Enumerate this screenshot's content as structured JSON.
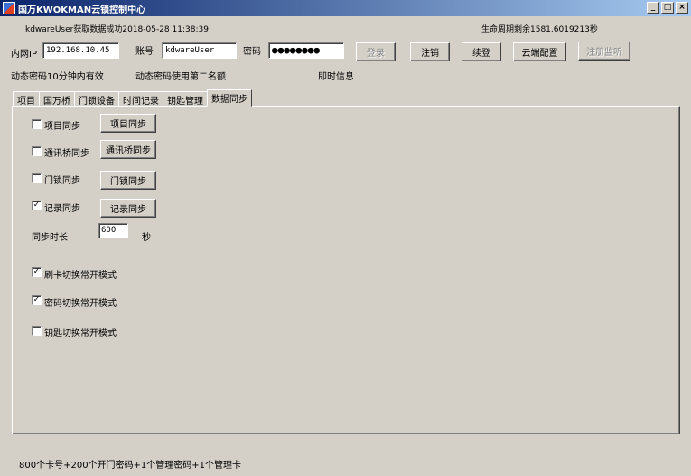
{
  "window": {
    "title": "国万KWOKMAN云锁控制中心"
  },
  "status": {
    "message": "kdwareUser获取数据成功2018-05-28 11:38:39",
    "lifecycle": "生命周期剩余1581.6019213秒"
  },
  "login": {
    "ip_label": "内网IP",
    "ip_value": "192.168.10.45",
    "account_label": "账号",
    "account_value": "kdwareUser",
    "password_label": "密码",
    "password_value": "●●●●●●●●",
    "buttons": {
      "login": "登录",
      "logout": "注销",
      "renew": "续登",
      "cloud_config": "云端配置",
      "register_listen": "注册监听"
    }
  },
  "info": {
    "dynamic_valid": "动态密码10分钟内有效",
    "dynamic_second": "动态密码使用第二名额",
    "realtime": "即时信息"
  },
  "tabs": [
    "项目",
    "国万桥",
    "门锁设备",
    "时间记录",
    "钥匙管理",
    "数据同步"
  ],
  "sync": {
    "project": {
      "label": "项目同步",
      "checked": false,
      "button": "项目同步"
    },
    "bridge": {
      "label": "通讯桥同步",
      "checked": false,
      "button": "通讯桥同步"
    },
    "lock": {
      "label": "门锁同步",
      "checked": false,
      "button": "门锁同步"
    },
    "record": {
      "label": "记录同步",
      "checked": true,
      "button": "记录同步"
    },
    "duration_label": "同步时长",
    "duration_value": "600",
    "duration_unit": "秒",
    "card_mode": {
      "label": "刷卡切换常开模式",
      "checked": true
    },
    "password_mode": {
      "label": "密码切换常开模式",
      "checked": true
    },
    "key_mode": {
      "label": "钥匙切换常开模式",
      "checked": false
    }
  },
  "footer": {
    "capacity": "800个卡号+200个开门密码+1个管理密码+1个管理卡"
  }
}
